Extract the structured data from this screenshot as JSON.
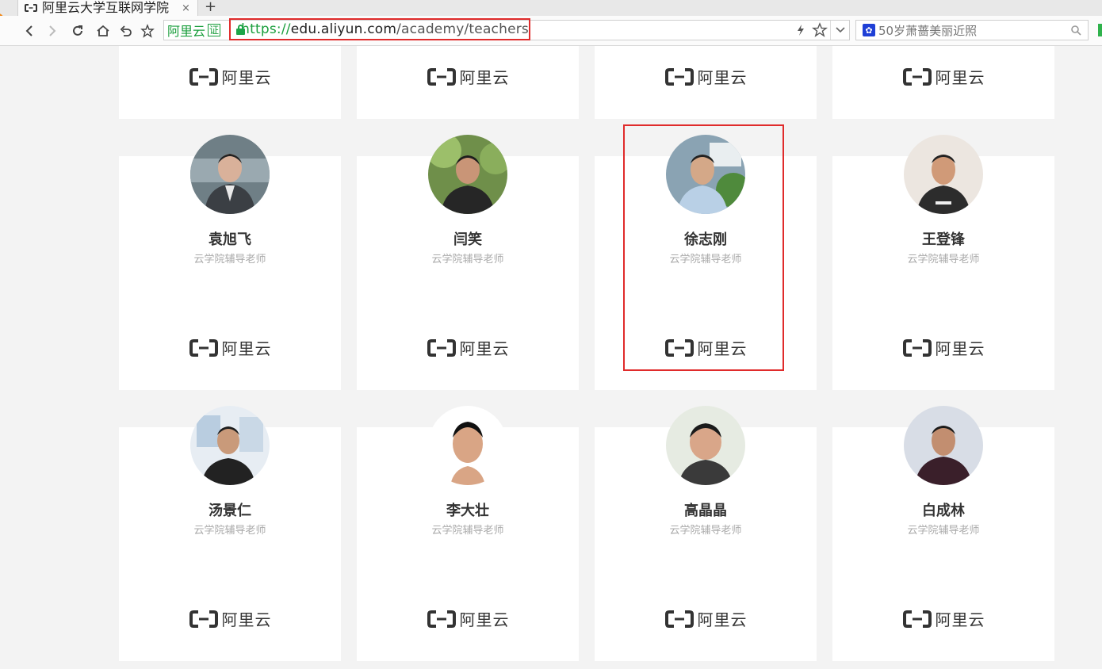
{
  "browser": {
    "tab_title": "阿里云大学互联网学院",
    "tab_close": "×",
    "new_tab": "+",
    "site_badge": "阿里云",
    "site_badge_cert": "证",
    "url_scheme": "https://",
    "url_host": "edu.aliyun.com",
    "url_path": "/academy/teachers",
    "search_query": "50岁萧蔷美丽近照"
  },
  "brand_word": "阿里云",
  "colors": {
    "highlight": "#e02b2b",
    "secure": "#1a9e3c",
    "card_bg": "#ffffff",
    "page_bg": "#f3f3f3"
  },
  "top_row": [
    {
      "brand": "阿里云"
    },
    {
      "brand": "阿里云"
    },
    {
      "brand": "阿里云"
    },
    {
      "brand": "阿里云"
    }
  ],
  "teachers_row1": [
    {
      "name": "袁旭飞",
      "role": "云学院辅导老师",
      "brand": "阿里云"
    },
    {
      "name": "闫笑",
      "role": "云学院辅导老师",
      "brand": "阿里云"
    },
    {
      "name": "徐志刚",
      "role": "云学院辅导老师",
      "brand": "阿里云"
    },
    {
      "name": "王登锋",
      "role": "云学院辅导老师",
      "brand": "阿里云"
    }
  ],
  "teachers_row2": [
    {
      "name": "汤景仁",
      "role": "云学院辅导老师",
      "brand": "阿里云"
    },
    {
      "name": "李大壮",
      "role": "云学院辅导老师",
      "brand": "阿里云"
    },
    {
      "name": "高晶晶",
      "role": "云学院辅导老师",
      "brand": "阿里云"
    },
    {
      "name": "白成林",
      "role": "云学院辅导老师",
      "brand": "阿里云"
    }
  ]
}
